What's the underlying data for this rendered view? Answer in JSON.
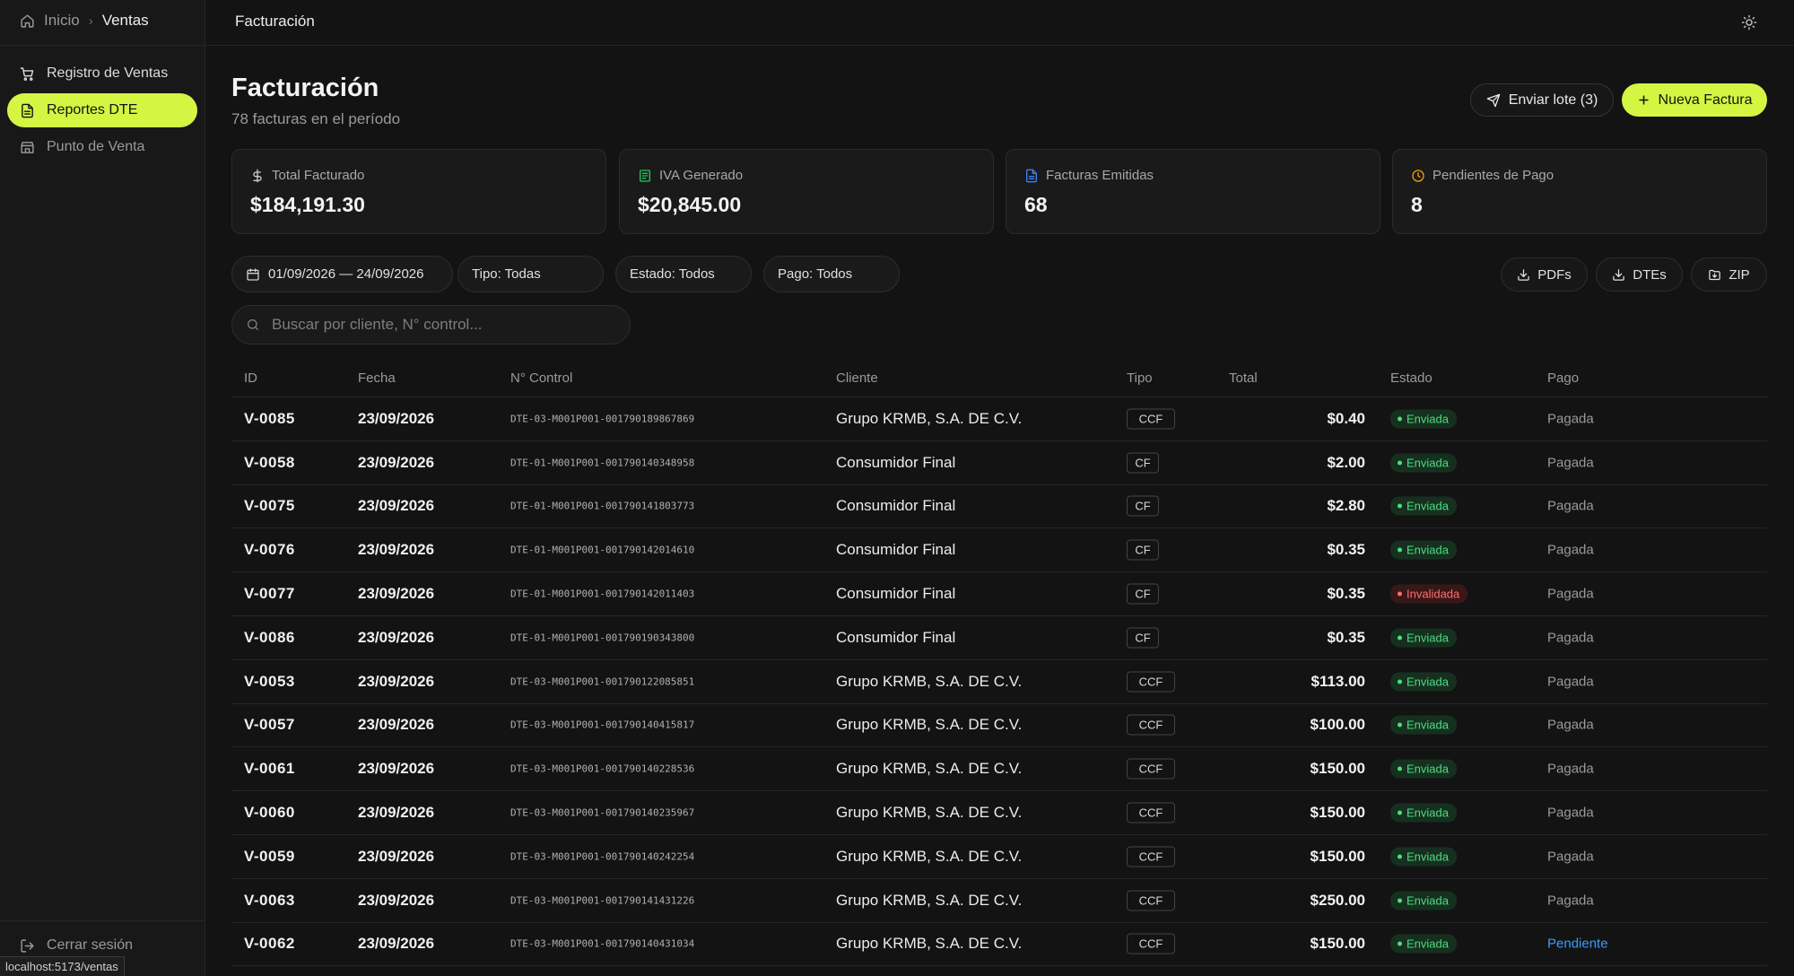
{
  "breadcrumb": {
    "home": "Inicio",
    "current": "Ventas"
  },
  "sidebar": {
    "items": [
      {
        "label": "Registro de Ventas",
        "icon": "cart-icon"
      },
      {
        "label": "Reportes DTE",
        "icon": "file-icon"
      },
      {
        "label": "Punto de Venta",
        "icon": "store-icon"
      }
    ],
    "logout": "Cerrar sesión"
  },
  "url_tooltip": "localhost:5173/ventas",
  "topbar": {
    "title": "Facturación",
    "theme_icon": "sun-icon"
  },
  "header": {
    "title": "Facturación",
    "subtitle": "78 facturas en el período",
    "send_batch": "Enviar lote (3)",
    "new_invoice": "Nueva Factura"
  },
  "stats": [
    {
      "label": "Total Facturado",
      "value": "$184,191.30",
      "icon": "dollar-icon",
      "color": "#cfcfcf"
    },
    {
      "label": "IVA Generado",
      "value": "$20,845.00",
      "icon": "receipt-icon",
      "color": "#22c55e"
    },
    {
      "label": "Facturas Emitidas",
      "value": "68",
      "icon": "document-icon",
      "color": "#3b82f6"
    },
    {
      "label": "Pendientes de Pago",
      "value": "8",
      "icon": "clock-icon",
      "color": "#f59e0b"
    }
  ],
  "filters": {
    "date_range": "01/09/2026 — 24/09/2026",
    "tipo": "Tipo: Todas",
    "estado": "Estado: Todos",
    "pago": "Pago: Todos"
  },
  "downloads": {
    "pdfs": "PDFs",
    "dtes": "DTEs",
    "zip": "ZIP"
  },
  "search": {
    "placeholder": "Buscar por cliente, N° control...",
    "value": ""
  },
  "table": {
    "columns": [
      "ID",
      "Fecha",
      "N° Control",
      "Cliente",
      "Tipo",
      "Total",
      "Estado",
      "Pago"
    ],
    "rows": [
      {
        "id": "V-0085",
        "fecha": "23/09/2026",
        "control": "DTE-03-M001P001-001790189867869",
        "cliente": "Grupo KRMB, S.A. DE C.V.",
        "tipo": "CCF",
        "total": "$0.40",
        "estado": "Enviada",
        "pago": "Pagada"
      },
      {
        "id": "V-0058",
        "fecha": "23/09/2026",
        "control": "DTE-01-M001P001-001790140348958",
        "cliente": "Consumidor Final",
        "tipo": "CF",
        "total": "$2.00",
        "estado": "Enviada",
        "pago": "Pagada"
      },
      {
        "id": "V-0075",
        "fecha": "23/09/2026",
        "control": "DTE-01-M001P001-001790141803773",
        "cliente": "Consumidor Final",
        "tipo": "CF",
        "total": "$2.80",
        "estado": "Enviada",
        "pago": "Pagada"
      },
      {
        "id": "V-0076",
        "fecha": "23/09/2026",
        "control": "DTE-01-M001P001-001790142014610",
        "cliente": "Consumidor Final",
        "tipo": "CF",
        "total": "$0.35",
        "estado": "Enviada",
        "pago": "Pagada"
      },
      {
        "id": "V-0077",
        "fecha": "23/09/2026",
        "control": "DTE-01-M001P001-001790142011403",
        "cliente": "Consumidor Final",
        "tipo": "CF",
        "total": "$0.35",
        "estado": "Invalidada",
        "pago": "Pagada"
      },
      {
        "id": "V-0086",
        "fecha": "23/09/2026",
        "control": "DTE-01-M001P001-001790190343800",
        "cliente": "Consumidor Final",
        "tipo": "CF",
        "total": "$0.35",
        "estado": "Enviada",
        "pago": "Pagada"
      },
      {
        "id": "V-0053",
        "fecha": "23/09/2026",
        "control": "DTE-03-M001P001-001790122085851",
        "cliente": "Grupo KRMB, S.A. DE C.V.",
        "tipo": "CCF",
        "total": "$113.00",
        "estado": "Enviada",
        "pago": "Pagada"
      },
      {
        "id": "V-0057",
        "fecha": "23/09/2026",
        "control": "DTE-03-M001P001-001790140415817",
        "cliente": "Grupo KRMB, S.A. DE C.V.",
        "tipo": "CCF",
        "total": "$100.00",
        "estado": "Enviada",
        "pago": "Pagada"
      },
      {
        "id": "V-0061",
        "fecha": "23/09/2026",
        "control": "DTE-03-M001P001-001790140228536",
        "cliente": "Grupo KRMB, S.A. DE C.V.",
        "tipo": "CCF",
        "total": "$150.00",
        "estado": "Enviada",
        "pago": "Pagada"
      },
      {
        "id": "V-0060",
        "fecha": "23/09/2026",
        "control": "DTE-03-M001P001-001790140235967",
        "cliente": "Grupo KRMB, S.A. DE C.V.",
        "tipo": "CCF",
        "total": "$150.00",
        "estado": "Enviada",
        "pago": "Pagada"
      },
      {
        "id": "V-0059",
        "fecha": "23/09/2026",
        "control": "DTE-03-M001P001-001790140242254",
        "cliente": "Grupo KRMB, S.A. DE C.V.",
        "tipo": "CCF",
        "total": "$150.00",
        "estado": "Enviada",
        "pago": "Pagada"
      },
      {
        "id": "V-0063",
        "fecha": "23/09/2026",
        "control": "DTE-03-M001P001-001790141431226",
        "cliente": "Grupo KRMB, S.A. DE C.V.",
        "tipo": "CCF",
        "total": "$250.00",
        "estado": "Enviada",
        "pago": "Pagada"
      },
      {
        "id": "V-0062",
        "fecha": "23/09/2026",
        "control": "DTE-03-M001P001-001790140431034",
        "cliente": "Grupo KRMB, S.A. DE C.V.",
        "tipo": "CCF",
        "total": "$150.00",
        "estado": "Enviada",
        "pago": "Pendiente"
      }
    ]
  },
  "colors": {
    "accent": "#d4f542",
    "success": "#4ade80",
    "danger": "#f87171",
    "link": "#3b9cff",
    "background": "#131313"
  }
}
